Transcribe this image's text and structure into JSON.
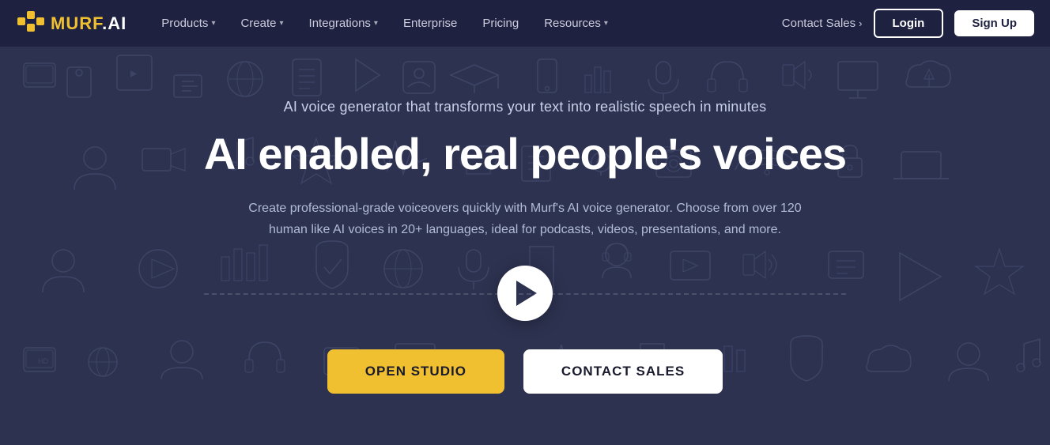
{
  "nav": {
    "logo_text": "MURF.AI",
    "logo_yellow": "MURF",
    "logo_white": ".AI",
    "links": [
      {
        "label": "Products",
        "has_dropdown": true
      },
      {
        "label": "Create",
        "has_dropdown": true
      },
      {
        "label": "Integrations",
        "has_dropdown": true
      },
      {
        "label": "Enterprise",
        "has_dropdown": false
      },
      {
        "label": "Pricing",
        "has_dropdown": false
      },
      {
        "label": "Resources",
        "has_dropdown": true
      }
    ],
    "contact_sales": "Contact Sales",
    "login_label": "Login",
    "signup_label": "Sign Up"
  },
  "hero": {
    "subtitle": "AI voice generator that transforms your text into realistic speech in minutes",
    "title": "AI enabled, real people's voices",
    "description": "Create professional-grade voiceovers quickly with Murf's AI voice generator. Choose from over 120 human like AI voices in 20+ languages, ideal for podcasts, videos, presentations, and more.",
    "open_studio_label": "OPEN STUDIO",
    "contact_sales_label": "CONTACT SALES"
  },
  "colors": {
    "bg": "#2d3250",
    "nav_bg": "#1e2140",
    "yellow": "#f0c030",
    "white": "#ffffff"
  }
}
